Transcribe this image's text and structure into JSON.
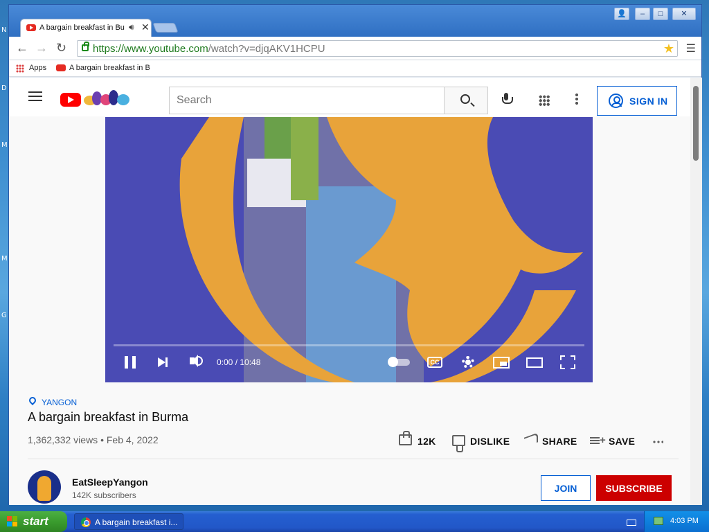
{
  "desktop": {
    "letters": [
      "N",
      "D",
      "M",
      "M",
      "G"
    ]
  },
  "browser": {
    "tab": {
      "title": "A bargain breakfast in Bu",
      "audio_icon": "speaker-icon",
      "close": "✕"
    },
    "address": {
      "scheme_host": "https://www.youtube.com",
      "path": "/watch?v=djqAKV1HCPU"
    },
    "bookmarks": {
      "apps": "Apps",
      "item": "A bargain breakfast in B"
    }
  },
  "youtube": {
    "search": {
      "placeholder": "Search"
    },
    "signin_label": "SIGN IN",
    "player": {
      "time": "0:00 / 10:48",
      "progress_fraction": 0.0,
      "cc_label": "CC",
      "state": "playing"
    },
    "video": {
      "location": "YANGON",
      "title": "A bargain breakfast in Burma",
      "views": "1,362,332 views",
      "separator": "•",
      "date": "Feb 4, 2022",
      "likes": "12K",
      "dislike_label": "DISLIKE",
      "share_label": "SHARE",
      "save_label": "SAVE"
    },
    "channel": {
      "name": "EatSleepYangon",
      "subscribers": "142K subscribers",
      "join_label": "JOIN",
      "subscribe_label": "SUBSCRIBE"
    }
  },
  "taskbar": {
    "start_label": "start",
    "task_label": "A bargain breakfast i...",
    "clock": "4:03 PM"
  },
  "colors": {
    "yt_red": "#ff0000",
    "subscribe_red": "#cc0000",
    "link_blue": "#065fd4",
    "video_blue": "#4a4bb4",
    "video_orange": "#e8a33a"
  }
}
